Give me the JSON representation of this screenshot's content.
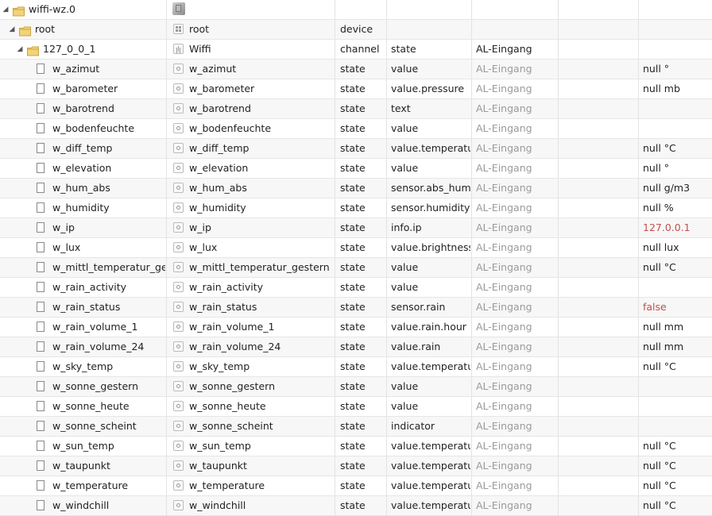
{
  "tree": {
    "rows": [
      {
        "level": 0,
        "kind": "folder",
        "expanded": true,
        "name": "wiffi-wz.0",
        "obj_icon": "device-cube-icon",
        "obj_name": "",
        "type": "",
        "role": "",
        "room": "",
        "room_dark": false,
        "value": "",
        "value_red": false
      },
      {
        "level": 1,
        "kind": "folder",
        "expanded": true,
        "name": "root",
        "obj_icon": "device-icon",
        "obj_name": "root",
        "type": "device",
        "role": "",
        "room": "",
        "room_dark": false,
        "value": "",
        "value_red": false
      },
      {
        "level": 2,
        "kind": "folder",
        "expanded": true,
        "name": "127_0_0_1",
        "obj_icon": "channel-icon",
        "obj_name": "Wiffi",
        "type": "channel",
        "role": "state",
        "room": "AL-Eingang",
        "room_dark": true,
        "value": "",
        "value_red": false
      },
      {
        "level": 3,
        "kind": "state",
        "name": "w_azimut",
        "obj_icon": "state-icon",
        "obj_name": "w_azimut",
        "type": "state",
        "role": "value",
        "room": "AL-Eingang",
        "room_dark": false,
        "value": "null °",
        "value_red": false
      },
      {
        "level": 3,
        "kind": "state",
        "name": "w_barometer",
        "obj_icon": "state-icon",
        "obj_name": "w_barometer",
        "type": "state",
        "role": "value.pressure",
        "room": "AL-Eingang",
        "room_dark": false,
        "value": "null mb",
        "value_red": false
      },
      {
        "level": 3,
        "kind": "state",
        "name": "w_barotrend",
        "obj_icon": "state-icon",
        "obj_name": "w_barotrend",
        "type": "state",
        "role": "text",
        "room": "AL-Eingang",
        "room_dark": false,
        "value": "",
        "value_red": false
      },
      {
        "level": 3,
        "kind": "state",
        "name": "w_bodenfeuchte",
        "obj_icon": "state-icon",
        "obj_name": "w_bodenfeuchte",
        "type": "state",
        "role": "value",
        "room": "AL-Eingang",
        "room_dark": false,
        "value": "",
        "value_red": false
      },
      {
        "level": 3,
        "kind": "state",
        "name": "w_diff_temp",
        "obj_icon": "state-icon",
        "obj_name": "w_diff_temp",
        "type": "state",
        "role": "value.temperature",
        "room": "AL-Eingang",
        "room_dark": false,
        "value": "null °C",
        "value_red": false
      },
      {
        "level": 3,
        "kind": "state",
        "name": "w_elevation",
        "obj_icon": "state-icon",
        "obj_name": "w_elevation",
        "type": "state",
        "role": "value",
        "room": "AL-Eingang",
        "room_dark": false,
        "value": "null °",
        "value_red": false
      },
      {
        "level": 3,
        "kind": "state",
        "name": "w_hum_abs",
        "obj_icon": "state-icon",
        "obj_name": "w_hum_abs",
        "type": "state",
        "role": "sensor.abs_humidity",
        "room": "AL-Eingang",
        "room_dark": false,
        "value": "null g/m3",
        "value_red": false
      },
      {
        "level": 3,
        "kind": "state",
        "name": "w_humidity",
        "obj_icon": "state-icon",
        "obj_name": "w_humidity",
        "type": "state",
        "role": "sensor.humidity",
        "room": "AL-Eingang",
        "room_dark": false,
        "value": "null %",
        "value_red": false
      },
      {
        "level": 3,
        "kind": "state",
        "name": "w_ip",
        "obj_icon": "state-icon",
        "obj_name": "w_ip",
        "type": "state",
        "role": "info.ip",
        "room": "AL-Eingang",
        "room_dark": false,
        "value": "127.0.0.1",
        "value_red": true
      },
      {
        "level": 3,
        "kind": "state",
        "name": "w_lux",
        "obj_icon": "state-icon",
        "obj_name": "w_lux",
        "type": "state",
        "role": "value.brightness",
        "room": "AL-Eingang",
        "room_dark": false,
        "value": "null lux",
        "value_red": false
      },
      {
        "level": 3,
        "kind": "state",
        "name": "w_mittl_temperatur_gestern",
        "obj_icon": "state-icon",
        "obj_name": "w_mittl_temperatur_gestern",
        "type": "state",
        "role": "value",
        "room": "AL-Eingang",
        "room_dark": false,
        "value": "null °C",
        "value_red": false
      },
      {
        "level": 3,
        "kind": "state",
        "name": "w_rain_activity",
        "obj_icon": "state-icon",
        "obj_name": "w_rain_activity",
        "type": "state",
        "role": "value",
        "room": "AL-Eingang",
        "room_dark": false,
        "value": "",
        "value_red": false
      },
      {
        "level": 3,
        "kind": "state",
        "name": "w_rain_status",
        "obj_icon": "state-icon",
        "obj_name": "w_rain_status",
        "type": "state",
        "role": "sensor.rain",
        "room": "AL-Eingang",
        "room_dark": false,
        "value": "false",
        "value_red": true
      },
      {
        "level": 3,
        "kind": "state",
        "name": "w_rain_volume_1",
        "obj_icon": "state-icon",
        "obj_name": "w_rain_volume_1",
        "type": "state",
        "role": "value.rain.hour",
        "room": "AL-Eingang",
        "room_dark": false,
        "value": "null mm",
        "value_red": false
      },
      {
        "level": 3,
        "kind": "state",
        "name": "w_rain_volume_24",
        "obj_icon": "state-icon",
        "obj_name": "w_rain_volume_24",
        "type": "state",
        "role": "value.rain",
        "room": "AL-Eingang",
        "room_dark": false,
        "value": "null mm",
        "value_red": false
      },
      {
        "level": 3,
        "kind": "state",
        "name": "w_sky_temp",
        "obj_icon": "state-icon",
        "obj_name": "w_sky_temp",
        "type": "state",
        "role": "value.temperature",
        "room": "AL-Eingang",
        "room_dark": false,
        "value": "null °C",
        "value_red": false
      },
      {
        "level": 3,
        "kind": "state",
        "name": "w_sonne_gestern",
        "obj_icon": "state-icon",
        "obj_name": "w_sonne_gestern",
        "type": "state",
        "role": "value",
        "room": "AL-Eingang",
        "room_dark": false,
        "value": "",
        "value_red": false
      },
      {
        "level": 3,
        "kind": "state",
        "name": "w_sonne_heute",
        "obj_icon": "state-icon",
        "obj_name": "w_sonne_heute",
        "type": "state",
        "role": "value",
        "room": "AL-Eingang",
        "room_dark": false,
        "value": "",
        "value_red": false
      },
      {
        "level": 3,
        "kind": "state",
        "name": "w_sonne_scheint",
        "obj_icon": "state-icon",
        "obj_name": "w_sonne_scheint",
        "type": "state",
        "role": "indicator",
        "room": "AL-Eingang",
        "room_dark": false,
        "value": "",
        "value_red": false
      },
      {
        "level": 3,
        "kind": "state",
        "name": "w_sun_temp",
        "obj_icon": "state-icon",
        "obj_name": "w_sun_temp",
        "type": "state",
        "role": "value.temperature",
        "room": "AL-Eingang",
        "room_dark": false,
        "value": "null °C",
        "value_red": false
      },
      {
        "level": 3,
        "kind": "state",
        "name": "w_taupunkt",
        "obj_icon": "state-icon",
        "obj_name": "w_taupunkt",
        "type": "state",
        "role": "value.temperature",
        "room": "AL-Eingang",
        "room_dark": false,
        "value": "null °C",
        "value_red": false
      },
      {
        "level": 3,
        "kind": "state",
        "name": "w_temperature",
        "obj_icon": "state-icon",
        "obj_name": "w_temperature",
        "type": "state",
        "role": "value.temperature",
        "room": "AL-Eingang",
        "room_dark": false,
        "value": "null °C",
        "value_red": false
      },
      {
        "level": 3,
        "kind": "state",
        "name": "w_windchill",
        "obj_icon": "state-icon",
        "obj_name": "w_windchill",
        "type": "state",
        "role": "value.temperature",
        "room": "AL-Eingang",
        "room_dark": false,
        "value": "null °C",
        "value_red": false
      }
    ]
  },
  "colors": {
    "value_highlight": "#c0504d",
    "room_muted": "#9a9a9a",
    "folder": "#e8c25a"
  }
}
